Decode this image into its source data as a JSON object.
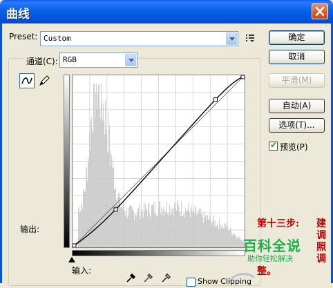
{
  "window": {
    "title": "曲线"
  },
  "preset": {
    "label": "Preset:",
    "value": "Custom"
  },
  "channel": {
    "label": "通道(C):",
    "value": "RGB"
  },
  "buttons": {
    "ok": "确定",
    "cancel": "取消",
    "smooth": "平滑(M)",
    "auto": "自动(A)",
    "options": "选项(T)...",
    "preview": "预览(P)"
  },
  "labels": {
    "output": "输出:",
    "input": "输入:",
    "show_clipping": "Show Clipping"
  },
  "curve": {
    "points_note_units": "input/output levels 0-255",
    "control_points": [
      [
        0,
        0
      ],
      [
        64,
        56
      ],
      [
        212,
        219
      ],
      [
        255,
        255
      ]
    ]
  },
  "annotation": {
    "step_lines": [
      "第十三步:",
      "整。"
    ],
    "vertical": "建调照调"
  },
  "watermark": {
    "main": "百科全说",
    "sub": "助你轻松解决"
  },
  "colors": {
    "title_bar": "#0a5ef0",
    "annotation": "#c00000",
    "watermark": "#1fae4e"
  }
}
